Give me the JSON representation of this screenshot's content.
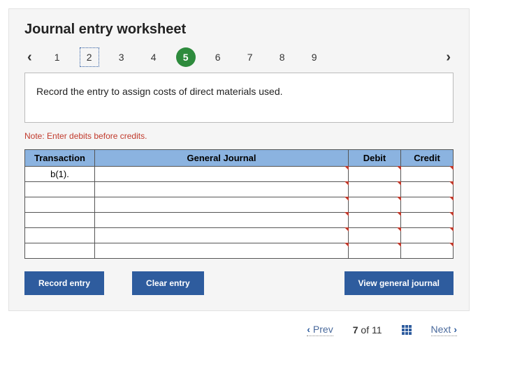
{
  "title": "Journal entry worksheet",
  "steps": [
    "1",
    "2",
    "3",
    "4",
    "5",
    "6",
    "7",
    "8",
    "9"
  ],
  "selected_step_index": 1,
  "current_step_index": 4,
  "instruction": "Record the entry to assign costs of direct materials used.",
  "note": "Note: Enter debits before credits.",
  "table": {
    "headers": {
      "transaction": "Transaction",
      "general_journal": "General Journal",
      "debit": "Debit",
      "credit": "Credit"
    },
    "rows": [
      {
        "transaction": "b(1).",
        "gj": "",
        "debit": "",
        "credit": ""
      },
      {
        "transaction": "",
        "gj": "",
        "debit": "",
        "credit": ""
      },
      {
        "transaction": "",
        "gj": "",
        "debit": "",
        "credit": ""
      },
      {
        "transaction": "",
        "gj": "",
        "debit": "",
        "credit": ""
      },
      {
        "transaction": "",
        "gj": "",
        "debit": "",
        "credit": ""
      },
      {
        "transaction": "",
        "gj": "",
        "debit": "",
        "credit": ""
      }
    ]
  },
  "buttons": {
    "record": "Record entry",
    "clear": "Clear entry",
    "view": "View general journal"
  },
  "footer": {
    "prev": "Prev",
    "next": "Next",
    "current": "7",
    "of_word": "of",
    "total": "11"
  },
  "glyphs": {
    "chev_left": "‹",
    "chev_right": "›"
  }
}
